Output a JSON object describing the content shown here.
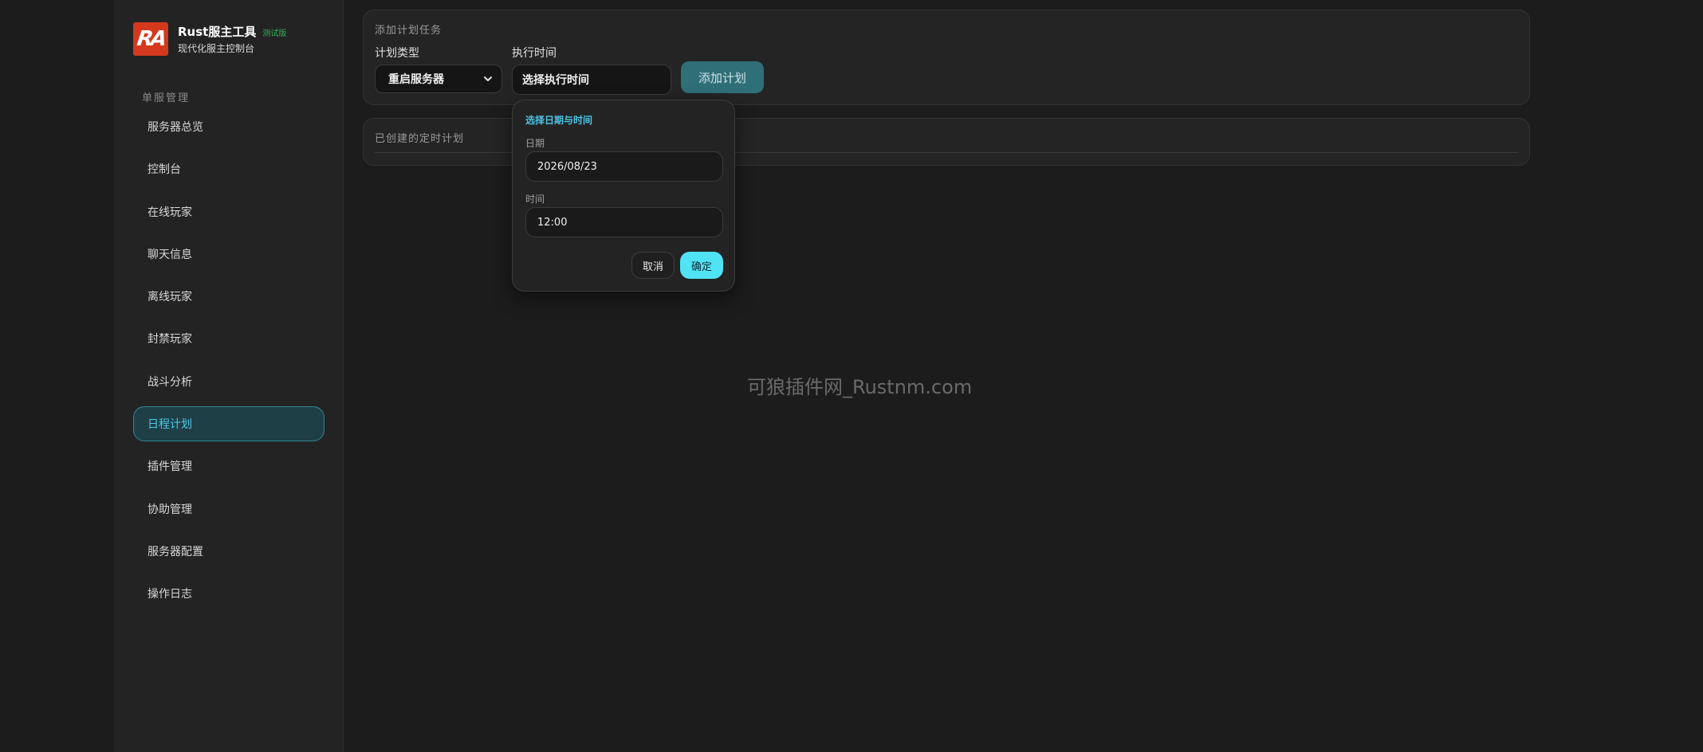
{
  "brand": {
    "logo_text": "RA",
    "title": "Rust服主工具",
    "badge": "测试版",
    "subtitle": "现代化服主控制台"
  },
  "sidebar": {
    "group_label": "单服管理",
    "items": [
      {
        "label": "服务器总览"
      },
      {
        "label": "控制台"
      },
      {
        "label": "在线玩家"
      },
      {
        "label": "聊天信息"
      },
      {
        "label": "离线玩家"
      },
      {
        "label": "封禁玩家"
      },
      {
        "label": "战斗分析"
      },
      {
        "label": "日程计划",
        "active": true
      },
      {
        "label": "插件管理"
      },
      {
        "label": "协助管理"
      },
      {
        "label": "服务器配置"
      },
      {
        "label": "操作日志"
      }
    ]
  },
  "add_task": {
    "title": "添加计划任务",
    "type_label": "计划类型",
    "type_value": "重启服务器",
    "time_label": "执行时间",
    "time_value": "选择执行时间",
    "add_button": "添加计划"
  },
  "task_list": {
    "title": "已创建的定时计划"
  },
  "picker": {
    "title": "选择日期与时间",
    "date_label": "日期",
    "date_value": "2026/08/23",
    "time_label": "时间",
    "time_value": "12:00",
    "cancel": "取消",
    "confirm": "确定"
  },
  "watermark": "可狼插件网_Rustnm.com",
  "colors": {
    "accent": "#4fe3f5",
    "active_nav_bg": "#1f3f47",
    "logo_bg": "#d4391e",
    "badge": "#35b05a"
  }
}
